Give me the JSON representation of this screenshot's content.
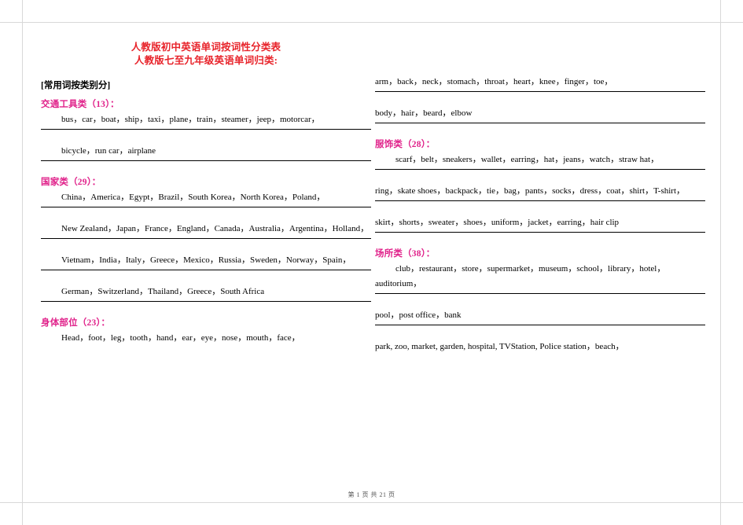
{
  "document": {
    "title_line1": "人教版初中英语单词按词性分类表",
    "title_line2": "人教版七至九年级英语单词归类:",
    "section_head": "[常用词按类别分]",
    "footer": "第 1 页 共 21 页"
  },
  "left_column": [
    {
      "heading": "交通工具类（13）：",
      "blocks": [
        "bus，car，boat，ship，taxi，plane，train，steamer，jeep，motorcar，",
        "bicycle，run car，airplane"
      ],
      "indent_first": true
    },
    {
      "heading": "国家类（29）：",
      "blocks": [
        "China，America，Egypt，Brazil，South Korea，North Korea，Poland，",
        "New Zealand，Japan，France，England，Canada，Australia，Argentina，Holland，",
        "Vietnam，India，Italy，Greece，Mexico，Russia，Sweden，Norway，Spain，",
        "German，Switzerland，Thailand，Greece，South Africa"
      ],
      "indent_first": true
    },
    {
      "heading": "身体部位（23）：",
      "blocks": [
        "Head，foot，leg，tooth，hand，ear，eye，nose，mouth，face，"
      ],
      "indent_first": true
    }
  ],
  "right_column": [
    {
      "heading": "",
      "blocks": [
        "arm，back，neck，stomach，throat，heart，knee，finger，toe，",
        "body，hair，beard，elbow"
      ],
      "indent_first": false
    },
    {
      "heading": "服饰类（28）：",
      "blocks": [
        "scarf，belt，sneakers，wallet，earring，hat，jeans，watch，straw hat，",
        "ring，skate shoes，backpack，tie，bag，pants，socks，dress，coat，shirt，T-shirt，",
        "skirt，shorts，sweater，shoes，uniform，jacket，earring，hair clip"
      ],
      "indent_first": true
    },
    {
      "heading": "场所类（38）：",
      "blocks": [
        "club，restaurant，store，supermarket，museum，school，library，hotel，auditorium，",
        "pool，post office，bank",
        "park, zoo, market, garden, hospital, TVStation, Police station，beach，"
      ],
      "indent_first": true
    }
  ]
}
